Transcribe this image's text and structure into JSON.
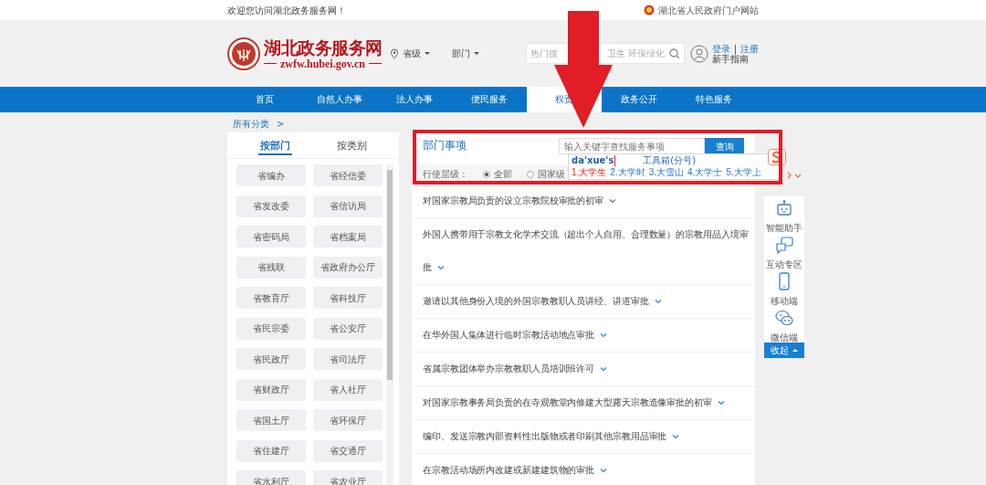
{
  "top_bar": {
    "welcome": "欢迎您访问湖北政务服务网！",
    "portal_link": "湖北省人民政府门户网站"
  },
  "header": {
    "site_name": "湖北政务服务网",
    "site_url": "zwfw.hubei.gov.cn",
    "level_selector": "省级",
    "department_selector": "部门",
    "search_visible_hint_parts": [
      "热门搜",
      "卫生 环保绿化"
    ],
    "login": "登录",
    "separator": "|",
    "register": "注册",
    "guide": "新手指南"
  },
  "nav": [
    {
      "label": "首页",
      "selected": false
    },
    {
      "label": "自然人办事",
      "selected": false
    },
    {
      "label": "法人办事",
      "selected": false
    },
    {
      "label": "便民服务",
      "selected": false
    },
    {
      "label": "权责",
      "selected": true
    },
    {
      "label": "政务公开",
      "selected": false
    },
    {
      "label": "特色服务",
      "selected": false
    }
  ],
  "breadcrumb": [
    "所有分类",
    ">"
  ],
  "left_tabs": [
    {
      "label": "按部门",
      "selected": true
    },
    {
      "label": "按类别",
      "selected": false
    }
  ],
  "departments": [
    "省编办",
    "省经信委",
    "省发改委",
    "省信访局",
    "省密码局",
    "省档案局",
    "省残联",
    "省政府办公厅",
    "省教育厅",
    "省科技厅",
    "省民宗委",
    "省公安厅",
    "省民政厅",
    "省司法厅",
    "省财政厅",
    "省人社厅",
    "省国土厅",
    "省环保厅",
    "省住建厅",
    "省交通厅",
    "省水利厅",
    "省农业厅"
  ],
  "search_panel": {
    "title": "部门事项",
    "placeholder": "输入关键字查找服务事项",
    "button": "查询",
    "filter_label": "行使层级：",
    "filter_options": [
      {
        "label": "全部",
        "selected": true
      },
      {
        "label": "国家级",
        "selected": false
      }
    ]
  },
  "ime_popup": {
    "input": "da'xue's",
    "toolbox": "工具箱(分号)",
    "candidates": [
      {
        "label": "1.大学生",
        "selected": true
      },
      {
        "label": "2.大学时",
        "selected": false
      },
      {
        "label": "3.大雪山",
        "selected": false
      },
      {
        "label": "4.大学士",
        "selected": false
      },
      {
        "label": "5.大学上",
        "selected": false
      }
    ]
  },
  "items": [
    "对国家宗教局负责的设立宗教院校审批的初审",
    "外国人携带用于宗教文化学术交流（超出个人自用、合理数量）的宗教用品入境审批",
    "邀请以其他身份入境的外国宗教教职人员讲经、讲道审批",
    "在华外国人集体进行临时宗教活动地点审批",
    "省属宗教团体举办宗教教职人员培训班许可",
    "对国家宗教事务局负责的在寺观教堂内修建大型露天宗教造像审批的初审",
    "编印、发送宗教内部资料性出版物或者印刷其他宗教用品审批",
    "在宗教活动场所内改建或新建建筑物的审批"
  ],
  "side_tools": [
    {
      "kind": "robot",
      "label": "智能助手"
    },
    {
      "kind": "chat",
      "label": "互动专区"
    },
    {
      "kind": "phone",
      "label": "移动端"
    },
    {
      "kind": "wechat",
      "label": "微信端"
    }
  ],
  "collapse_button": "收起",
  "annotations": {
    "arrow": true,
    "highlight_box": true
  }
}
